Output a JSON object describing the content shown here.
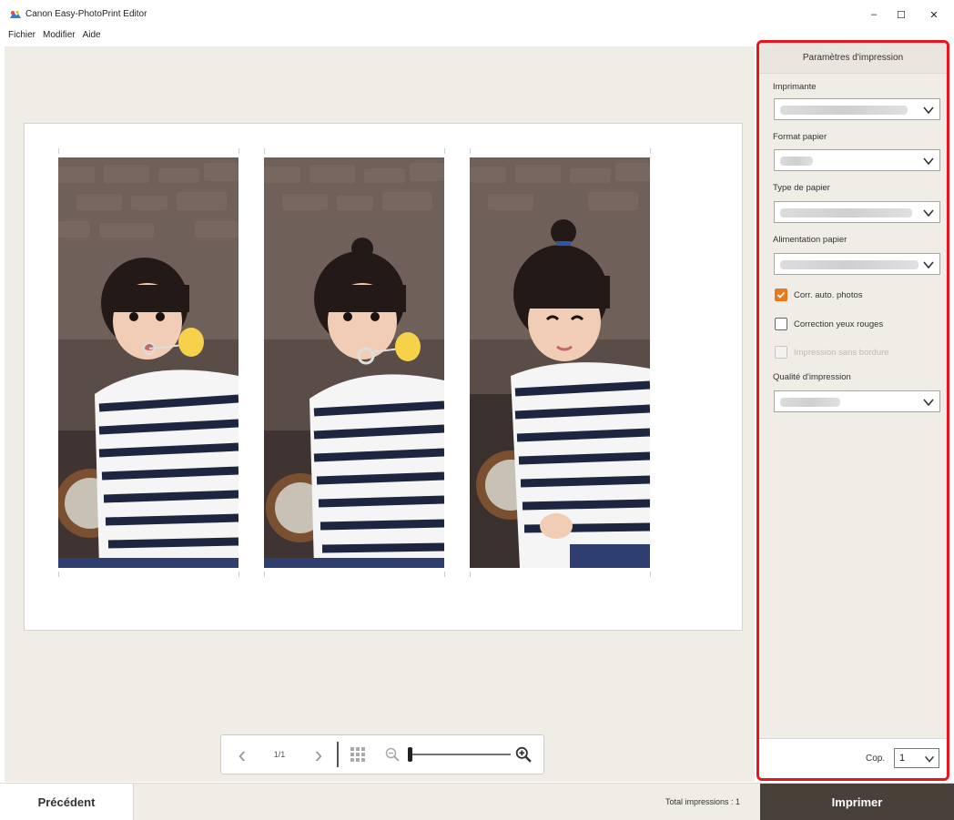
{
  "window": {
    "title": "Canon Easy-PhotoPrint Editor",
    "minimize_glyph": "–",
    "maximize_glyph": "☐",
    "close_glyph": "✕"
  },
  "menu": [
    "Fichier",
    "Modifier",
    "Aide"
  ],
  "preview": {
    "photos": [
      {
        "icon": "photo-girl-bubble-1"
      },
      {
        "icon": "photo-girl-bubble-2"
      },
      {
        "icon": "photo-girl-smiling"
      }
    ]
  },
  "zoom_toolbar": {
    "prev_glyph": "‹",
    "page_indicator": "1/1",
    "next_glyph": "›",
    "grid_icon": "grid-view-icon",
    "zoom_out_icon": "zoom-out-icon",
    "zoom_in_icon": "zoom-in-icon",
    "zoom_level": 0.0
  },
  "print_settings": {
    "header": "Paramètres d'impression",
    "printer_label": "Imprimante",
    "paper_size_label": "Format papier",
    "paper_type_label": "Type de papier",
    "paper_source_label": "Alimentation papier",
    "auto_correct_label": "Corr. auto. photos",
    "auto_correct_checked": true,
    "red_eye_label": "Correction yeux rouges",
    "red_eye_checked": false,
    "borderless_label": "Impression sans bordure",
    "borderless_enabled": false,
    "quality_label": "Qualité d'impression",
    "copies_label": "Cop.",
    "copies_value": "1"
  },
  "bottom": {
    "prev_button": "Précédent",
    "total_prints": "Total impressions : 1",
    "print_button": "Imprimer"
  },
  "colors": {
    "accent_orange": "#e8791a",
    "highlight_red": "#e8151c",
    "print_button_bg": "#4a403a",
    "workspace_bg": "#f0ede7"
  }
}
